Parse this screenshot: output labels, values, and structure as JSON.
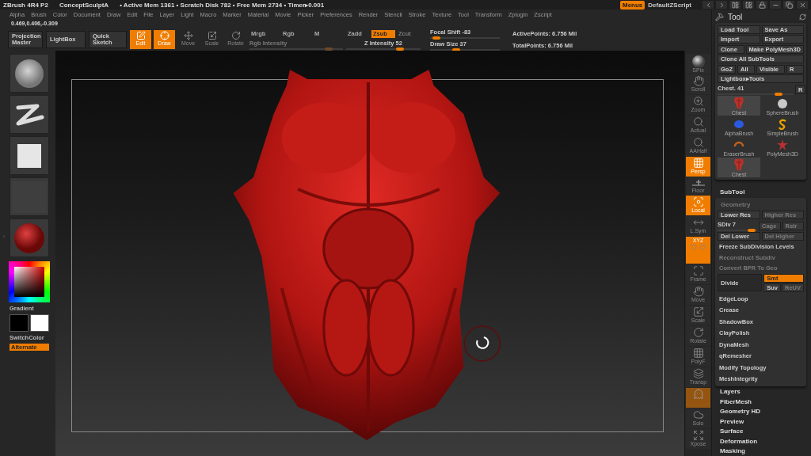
{
  "title_bar": {
    "app": "ZBrush 4R4 P2",
    "document": "ConceptSculptA",
    "status": "• Active Mem 1361 • Scratch Disk 782 • Free Mem 2734 • Timer▸0.001",
    "menus_button": {
      "label": "Menus",
      "on": true
    },
    "script": "DefaultZScript"
  },
  "menu_bar": [
    "Alpha",
    "Brush",
    "Color",
    "Document",
    "Draw",
    "Edit",
    "File",
    "Layer",
    "Light",
    "Macro",
    "Marker",
    "Material",
    "Movie",
    "Picker",
    "Preferences",
    "Render",
    "Stencil",
    "Stroke",
    "Texture",
    "Tool",
    "Transform",
    "Zplugin",
    "Zscript"
  ],
  "coordinates": "0.469,0.406,-0.309",
  "toolbar": {
    "big_buttons": [
      {
        "label": "Projection Master"
      },
      {
        "label": "LightBox"
      },
      {
        "label": "Quick Sketch"
      }
    ],
    "modes": [
      {
        "label": "Edit",
        "kind": "edit",
        "on": true
      },
      {
        "label": "Draw",
        "kind": "draw",
        "on": true
      },
      {
        "label": "Move",
        "kind": "move",
        "on": false
      },
      {
        "label": "Scale",
        "kind": "scale",
        "on": false
      },
      {
        "label": "Rotate",
        "kind": "rotate",
        "on": false
      }
    ],
    "channels": [
      {
        "label": "Mrgb",
        "on": false,
        "disabled": false
      },
      {
        "label": "Rgb",
        "on": false,
        "disabled": false
      },
      {
        "label": "M",
        "on": false,
        "disabled": false
      }
    ],
    "depth": [
      {
        "label": "Zadd",
        "on": false,
        "disabled": false
      },
      {
        "label": "Zsub",
        "on": true,
        "disabled": false
      },
      {
        "label": "Zcut",
        "on": false,
        "disabled": true
      }
    ],
    "rgb_intensity": {
      "label": "Rgb Intensity",
      "level": 0.85,
      "disabled": true
    },
    "z_intensity": {
      "label": "Z Intensity 52",
      "level": 0.72
    },
    "focal_shift": {
      "label": "Focal Shift -83",
      "level": 0.09
    },
    "draw_size": {
      "label": "Draw Size 37",
      "level": 0.38
    },
    "stats": [
      "ActivePoints: 6.756 Mil",
      "TotalPoints: 6.756 Mil"
    ]
  },
  "left_shelf": {
    "thumbnails": [
      {
        "kind": "brush"
      },
      {
        "kind": "stroke"
      },
      {
        "kind": "alpha"
      },
      {
        "kind": "texture"
      },
      {
        "kind": "material"
      }
    ],
    "gradient_label": "Gradient",
    "switch_color_label": "SwitchColor",
    "alternate": {
      "label": "Alternate",
      "on": true
    }
  },
  "right_shelf": [
    {
      "label": "SPix",
      "kind": "spix",
      "on": false
    },
    {
      "label": "Scroll",
      "kind": "scroll",
      "on": false
    },
    {
      "label": "Zoom",
      "kind": "zoom",
      "on": false
    },
    {
      "label": "Actual",
      "kind": "actual",
      "on": false
    },
    {
      "label": "AAHalf",
      "kind": "aahalf",
      "on": false
    },
    {
      "label": "Persp",
      "kind": "persp",
      "on": true
    },
    {
      "label": "Floor",
      "kind": "floor",
      "on": false
    },
    {
      "label": "Local",
      "kind": "local",
      "on": true
    },
    {
      "label": "L.Sym",
      "kind": "lsym",
      "on": false
    },
    {
      "label": "XYZ",
      "kind": "xyz",
      "on": true
    },
    {
      "label": "Frame",
      "kind": "frame",
      "on": false
    },
    {
      "label": "Move",
      "kind": "move",
      "on": false
    },
    {
      "label": "Scale",
      "kind": "scale",
      "on": false
    },
    {
      "label": "Rotate",
      "kind": "rotate",
      "on": false
    },
    {
      "label": "PolyF",
      "kind": "polyf",
      "on": false
    },
    {
      "label": "Transp",
      "kind": "transp",
      "on": false
    },
    {
      "kind": "ghost",
      "on": true
    },
    {
      "label": "Solo",
      "kind": "solo",
      "on": false
    },
    {
      "label": "Xpose",
      "kind": "xpose",
      "on": false
    }
  ],
  "tool_panel": {
    "title": "Tool",
    "rows": [
      {
        "buttons": [
          {
            "label": "Load Tool"
          },
          {
            "label": "Save As"
          }
        ]
      },
      {
        "buttons": [
          {
            "label": "Import"
          },
          {
            "label": "Export"
          }
        ]
      },
      {
        "buttons": [
          {
            "label": "Clone"
          },
          {
            "label": "Make PolyMesh3D"
          }
        ]
      },
      {
        "buttons": [
          {
            "label": "Clone All SubTools"
          }
        ]
      },
      {
        "buttons": [
          {
            "label": "GoZ"
          },
          {
            "label": "All"
          },
          {
            "label": "Visible"
          },
          {
            "label": "R"
          }
        ]
      },
      {
        "buttons": [
          {
            "label": "Lightbox▸Tools"
          }
        ]
      }
    ],
    "tool_slider": {
      "label": "Chest. 41",
      "level": 0.8,
      "reset": "R"
    },
    "thumbnails": [
      {
        "label": "Chest",
        "kind": "mesh",
        "selected": true
      },
      {
        "label": "SphereBrush",
        "kind": "sphere",
        "selected": false
      },
      {
        "label": "AlphaBrush",
        "kind": "alpha",
        "selected": false
      },
      {
        "label": "SimpleBrush",
        "kind": "simple",
        "selected": false
      },
      {
        "label": "EraserBrush",
        "kind": "eraser",
        "selected": false
      },
      {
        "label": "PolyMesh3D",
        "kind": "star",
        "selected": false
      },
      {
        "label": "Chest",
        "kind": "mesh",
        "selected": true
      }
    ],
    "subtool": "SubTool",
    "geometry": {
      "title": "Geometry",
      "rows": [
        [
          {
            "kind": "button",
            "label": "Lower Res",
            "disabled": false
          },
          {
            "kind": "button",
            "label": "Higher Res",
            "disabled": true
          }
        ],
        [
          {
            "kind": "slider",
            "label": "SDiv 7",
            "level": 0.85
          },
          {
            "kind": "button",
            "label": "Cage",
            "disabled": true
          },
          {
            "kind": "button",
            "label": "Rstr",
            "disabled": true
          }
        ],
        [
          {
            "kind": "button",
            "label": "Del Lower",
            "disabled": false
          },
          {
            "kind": "button",
            "label": "Del Higher",
            "disabled": true
          }
        ],
        [
          {
            "kind": "text",
            "label": "Freeze SubDivision Levels",
            "disabled": false
          }
        ],
        [
          {
            "kind": "text",
            "label": "Reconstruct Subdiv",
            "disabled": true
          }
        ],
        [
          {
            "kind": "text",
            "label": "Convert BPR To Geo",
            "disabled": true
          }
        ]
      ],
      "divide": {
        "label": "Divide",
        "options": [
          {
            "label": "Smt",
            "on": true,
            "disabled": false
          },
          {
            "label": "Suv",
            "on": false,
            "disabled": false
          },
          {
            "label": "ReUV",
            "on": false,
            "disabled": true
          }
        ]
      },
      "subpalettes": [
        "EdgeLoop",
        "Crease",
        "ShadowBox",
        "ClayPolish",
        "DynaMesh",
        "qRemesher",
        "Modify Topology",
        "MeshIntegrity"
      ]
    },
    "sections": [
      "Layers",
      "FiberMesh",
      "Geometry HD",
      "Preview",
      "Surface",
      "Deformation",
      "Masking"
    ]
  }
}
